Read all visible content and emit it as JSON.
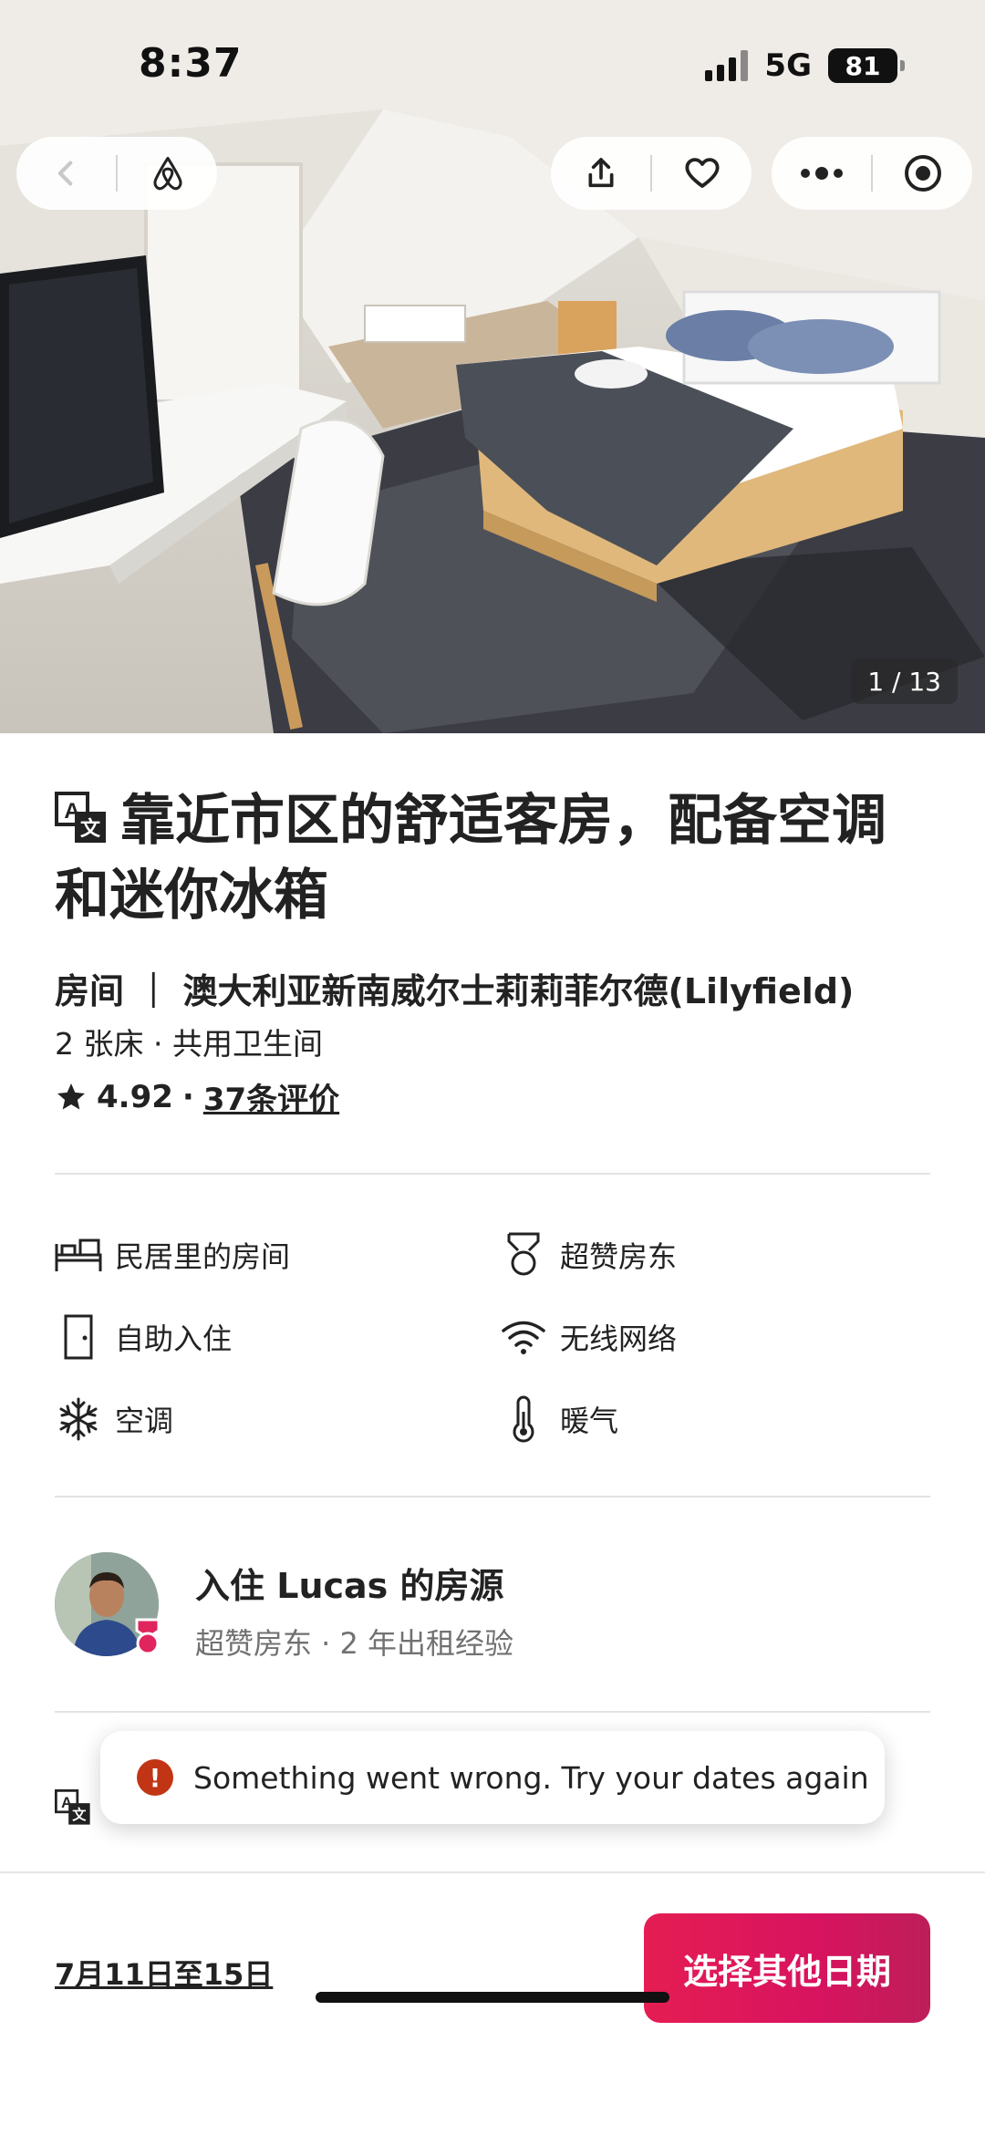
{
  "status_bar": {
    "time": "8:37",
    "network": "5G",
    "battery": "81"
  },
  "hero": {
    "photo_counter": "1 / 13"
  },
  "toolbar": {
    "back_icon": "chevron-left-icon",
    "logo_icon": "airbnb-logo-icon",
    "share_icon": "share-icon",
    "save_icon": "heart-icon",
    "more_icon": "more-dots-icon",
    "close_icon": "target-icon"
  },
  "listing": {
    "title": "靠近市区的舒适客房，配备空调和迷你冰箱",
    "subtitle": "房间 ｜ 澳大利亚新南威尔士莉莉菲尔德(Lilyfield)",
    "meta": "2 张床 · 共用卫生间",
    "rating": "4.92",
    "rating_sep": "·",
    "reviews": "37条评价"
  },
  "amenities": [
    {
      "icon": "bed-icon",
      "label": "民居里的房间"
    },
    {
      "icon": "superhost-medal-icon",
      "label": "超赞房东"
    },
    {
      "icon": "door-icon",
      "label": "自助入住"
    },
    {
      "icon": "wifi-icon",
      "label": "无线网络"
    },
    {
      "icon": "snowflake-icon",
      "label": "空调"
    },
    {
      "icon": "thermometer-icon",
      "label": "暖气"
    }
  ],
  "host": {
    "title": "入住 Lucas 的房源",
    "subtitle": "超赞房东 · 2 年出租经验"
  },
  "toast": {
    "message": "Something went wrong. Try your dates again",
    "icon": "!"
  },
  "footer": {
    "dates": "7月11日至15日",
    "cta": "选择其他日期"
  },
  "colors": {
    "accent": "#e51d53",
    "error": "#c13515",
    "muted": "#717171"
  }
}
